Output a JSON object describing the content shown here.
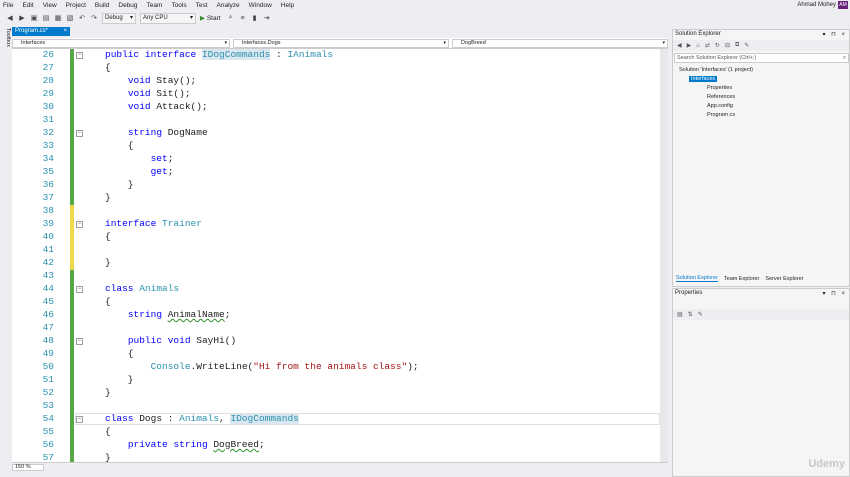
{
  "menu": [
    "File",
    "Edit",
    "View",
    "Project",
    "Build",
    "Debug",
    "Team",
    "Tools",
    "Test",
    "Analyze",
    "Window",
    "Help"
  ],
  "user": "Ahmad Mohey",
  "avatar": "AM",
  "toolbar": {
    "config": "Debug",
    "platform": "Any CPU",
    "start": "Start"
  },
  "left_tab": "Toolbox",
  "document_tab": "Program.cs*",
  "nav": {
    "project": "Interfaces",
    "class": "Interfaces.Dogs",
    "member": "DogBreed"
  },
  "zoom": "150 %",
  "solution_explorer": {
    "title": "Solution Explorer",
    "search_placeholder": "Search Solution Explorer (Ctrl+;)",
    "items": [
      "Solution 'Interfaces' (1 project)",
      "Interfaces",
      "Properties",
      "References",
      "App.config",
      "Program.cs"
    ],
    "tabs": [
      "Solution Explorer",
      "Team Explorer",
      "Server Explorer"
    ]
  },
  "properties": {
    "title": "Properties"
  },
  "watermark": "Udemy",
  "lines": [
    {
      "n": "26",
      "t": "public interface IDogCommands : IAnimals"
    },
    {
      "n": "27",
      "t": "{"
    },
    {
      "n": "28",
      "t": "    void Stay();"
    },
    {
      "n": "29",
      "t": "    void Sit();"
    },
    {
      "n": "30",
      "t": "    void Attack();"
    },
    {
      "n": "31",
      "t": ""
    },
    {
      "n": "32",
      "t": "    string DogName"
    },
    {
      "n": "33",
      "t": "    {"
    },
    {
      "n": "34",
      "t": "        set;"
    },
    {
      "n": "35",
      "t": "        get;"
    },
    {
      "n": "36",
      "t": "    }"
    },
    {
      "n": "37",
      "t": "}"
    },
    {
      "n": "38",
      "t": ""
    },
    {
      "n": "39",
      "t": "interface Trainer"
    },
    {
      "n": "40",
      "t": "{"
    },
    {
      "n": "41",
      "t": ""
    },
    {
      "n": "42",
      "t": "}"
    },
    {
      "n": "43",
      "t": ""
    },
    {
      "n": "44",
      "t": "class Animals"
    },
    {
      "n": "45",
      "t": "{"
    },
    {
      "n": "46",
      "t": "    string AnimalName;"
    },
    {
      "n": "47",
      "t": ""
    },
    {
      "n": "48",
      "t": "    public void SayHi()"
    },
    {
      "n": "49",
      "t": "    {"
    },
    {
      "n": "50",
      "t": "        Console.WriteLine(\"Hi from the animals class\");"
    },
    {
      "n": "51",
      "t": "    }"
    },
    {
      "n": "52",
      "t": "}"
    },
    {
      "n": "53",
      "t": ""
    },
    {
      "n": "54",
      "t": "class Dogs : Animals, IDogCommands"
    },
    {
      "n": "55",
      "t": "{"
    },
    {
      "n": "56",
      "t": "    private string DogBreed;"
    },
    {
      "n": "57",
      "t": "}"
    }
  ],
  "colors": {
    "keyword": "#0000ff",
    "type": "#2b91af",
    "string": "#a31515",
    "accent": "#007acc",
    "saved_bar": "#57a64a",
    "unsaved_bar": "#efd94a"
  }
}
